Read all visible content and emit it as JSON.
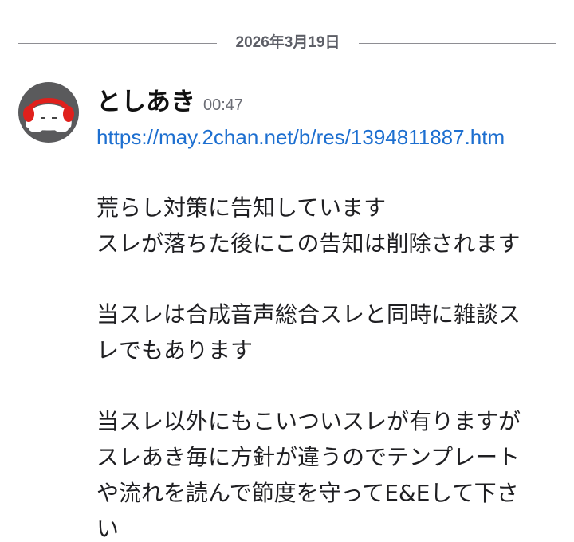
{
  "divider": {
    "date": "2026年3月19日"
  },
  "message": {
    "author": "としあき",
    "time": "00:47",
    "link": "https://may.2chan.net/b/res/1394811887.htm",
    "paragraphs": [
      [
        "荒らし対策に告知しています",
        "スレが落ちた後にこの告知は削除されます"
      ],
      [
        "当スレは合成音声総合スレと同時に雑談ス",
        "レでもあります"
      ],
      [
        "当スレ以外にもこいついスレが有りますが",
        "スレあき毎に方針が違うのでテンプレート",
        "や流れを読んで節度を守ってE&Eして下さ",
        "い"
      ]
    ]
  },
  "colors": {
    "link": "#1d6fd0",
    "divider_text": "#5c5e66",
    "avatar_bg": "#5a5a5c",
    "avatar_headphones": "#e0201c"
  },
  "icons": {
    "avatar": "white-blob-with-red-headphones"
  }
}
